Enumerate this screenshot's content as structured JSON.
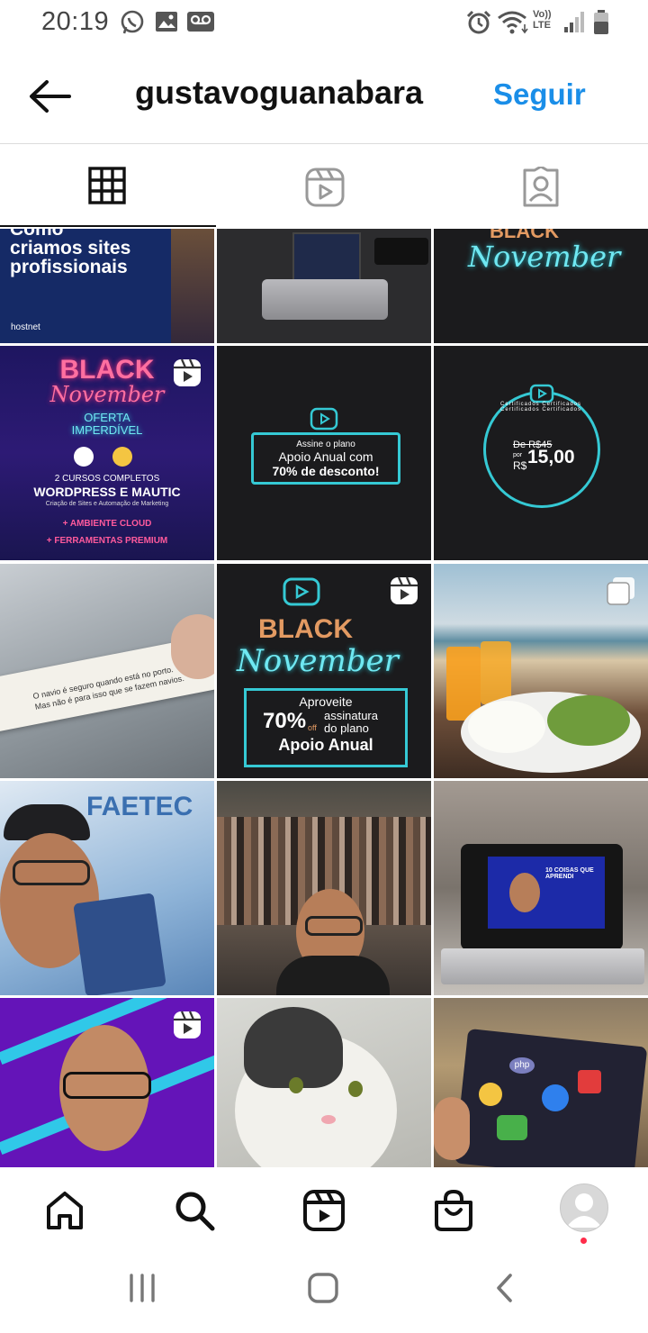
{
  "status_bar": {
    "time": "20:19",
    "left_icons": [
      "whatsapp-icon",
      "image-icon",
      "voicemail-icon"
    ],
    "right_icons": [
      "alarm-icon",
      "wifi-icon",
      "volte-icon",
      "signal-icon",
      "battery-icon"
    ],
    "volte_top": "Vo))",
    "volte_bottom": "LTE"
  },
  "header": {
    "back_icon": "arrow-left-icon",
    "username": "gustavoguanabara",
    "follow_label": "Seguir",
    "follow_color": "#1a8ee8"
  },
  "tabs": [
    {
      "icon": "grid-icon",
      "active": true
    },
    {
      "icon": "reels-icon",
      "active": false
    },
    {
      "icon": "tagged-icon",
      "active": false
    }
  ],
  "grid": {
    "tile1": {
      "line1": "Como",
      "line2": "criamos sites",
      "line3": "profissionais",
      "brand": "hostnet"
    },
    "tile3": {
      "line1": "BLACK",
      "line2": "November"
    },
    "tile4": {
      "line1": "BLACK",
      "line2": "November",
      "line3": "OFERTA",
      "line4": "IMPERDÍVEL",
      "line5": "2 CURSOS COMPLETOS",
      "line6": "WORDPRESS E MAUTIC",
      "line7": "Criação de Sites e Automação de Marketing",
      "line8": "+ AMBIENTE CLOUD",
      "line9": "+ FERRAMENTAS PREMIUM",
      "badge": "reel-badge-icon"
    },
    "tile5": {
      "line1": "Assine o plano",
      "line2": "Apoio Anual com",
      "line3": "70% de desconto!"
    },
    "tile6": {
      "ring": "Certificados Certificados Certificados Certificados",
      "old_price": "De R$45",
      "por": "por",
      "currency": "R$",
      "price": "15,00"
    },
    "tile7": {
      "line1": "O navio é seguro quando está no porto.",
      "line2": "Mas não é para isso que se fazem navios."
    },
    "tile8": {
      "line1": "BLACK",
      "line2": "November",
      "line3": "Aproveite",
      "percent": "70%",
      "off": "off",
      "line4": "assinatura",
      "line5": "do plano",
      "line6": "Apoio Anual",
      "badge": "reel-badge-icon"
    },
    "tile9": {
      "badge": "carousel-badge-icon"
    },
    "tile10": {
      "sign": "FAETEC"
    },
    "tile12": {
      "screen_text": "10 COISAS QUE APRENDI"
    },
    "tile13": {
      "badge": "reel-badge-icon"
    },
    "tile15": {
      "sticker": "php"
    }
  },
  "bottom_nav": {
    "items": [
      "home-icon",
      "search-icon",
      "reels-icon",
      "shop-icon",
      "profile-avatar"
    ],
    "notification_color": "#ff2c4a"
  },
  "system_nav": {
    "items": [
      "recent-apps-icon",
      "home-button-icon",
      "back-button-icon"
    ]
  }
}
